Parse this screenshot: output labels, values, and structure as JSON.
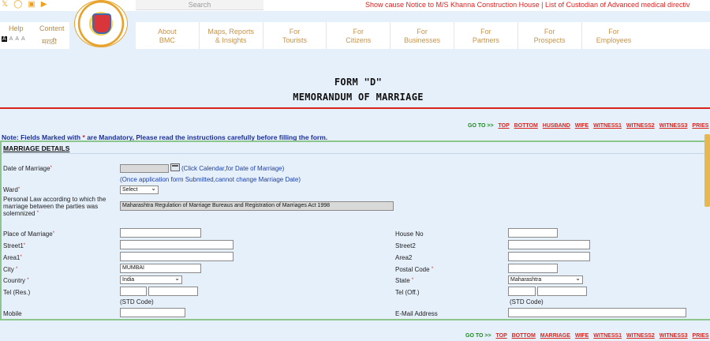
{
  "header": {
    "social_icons": [
      "twitter-icon",
      "instagram-icon",
      "facebook-icon",
      "youtube-icon"
    ],
    "search_placeholder": "Search",
    "marquee": "Show cause Notice to M/S Khanna Construction House | List of Custodian of Advanced medical directiv",
    "help": "Help",
    "content": "Content",
    "font_sizes": [
      "A",
      "A",
      "A",
      "A"
    ],
    "language": "मराठी",
    "nav": [
      {
        "line1": "About",
        "line2": "BMC"
      },
      {
        "line1": "Maps, Reports",
        "line2": "& Insights"
      },
      {
        "line1": "For",
        "line2": "Tourists"
      },
      {
        "line1": "For",
        "line2": "Citizens"
      },
      {
        "line1": "For",
        "line2": "Businesses"
      },
      {
        "line1": "For",
        "line2": "Partners"
      },
      {
        "line1": "For",
        "line2": "Prospects"
      },
      {
        "line1": "For",
        "line2": "Employees"
      }
    ]
  },
  "title": {
    "line1": "FORM \"D\"",
    "line2": "MEMORANDUM OF MARRIAGE"
  },
  "goto_top": {
    "label": "GO TO >>",
    "links": [
      "TOP",
      "BOTTOM",
      "HUSBAND",
      "WIFE",
      "WITNESS1",
      "WITNESS2",
      "WITNESS3",
      "PRIES"
    ]
  },
  "goto_bottom": {
    "label": "GO TO >>",
    "links": [
      "TOP",
      "BOTTOM",
      "MARRIAGE",
      "WIFE",
      "WITNESS1",
      "WITNESS2",
      "WITNESS3",
      "PRIES"
    ]
  },
  "note": {
    "prefix": "Note: Fields Marked with",
    "star": "*",
    "suffix": "are Mandatory, Please read the instructions carefully before filling the form."
  },
  "form": {
    "section_title": "MARRIAGE DETAILS",
    "req_mark": "*",
    "date_label": "Date of Marriage",
    "date_value": "",
    "calendar_hint": "(Click Calendar,for Date of Marriage)",
    "date_note": "(Once application form Submitted,cannot change Marriage Date)",
    "ward_label": "Ward",
    "ward_value": "Select",
    "personal_law_label": "Personal Law according to which the marriage between the parties was solemnized",
    "personal_law_value": "Maharashtra Regulation of Marriage Bureaus and Registration of Marriages Act 1998",
    "place_label": "Place of Marriage",
    "place_value": "",
    "house_label": "House No",
    "house_value": "",
    "street1_label": "Street1",
    "street1_value": "",
    "street2_label": "Street2",
    "street2_value": "",
    "area1_label": "Area1",
    "area1_value": "",
    "area2_label": "Area2",
    "area2_value": "",
    "city_label": "City",
    "city_value": "MUMBAI",
    "postal_label": "Postal Code",
    "postal_value": "",
    "country_label": "Country",
    "country_value": "India",
    "state_label": "State",
    "state_value": "Maharashtra",
    "tel_res_label": "Tel (Res.)",
    "tel_off_label": "Tel (Off.)",
    "std_code": "(STD Code)",
    "mobile_label": "Mobile",
    "mobile_value": "",
    "email_label": "E-Mail Address",
    "email_value": ""
  },
  "colors": {
    "accent_red": "#d9251d",
    "nav_text": "#c79349",
    "page_bg": "#e6f0fb",
    "form_border": "#8cc68c"
  }
}
